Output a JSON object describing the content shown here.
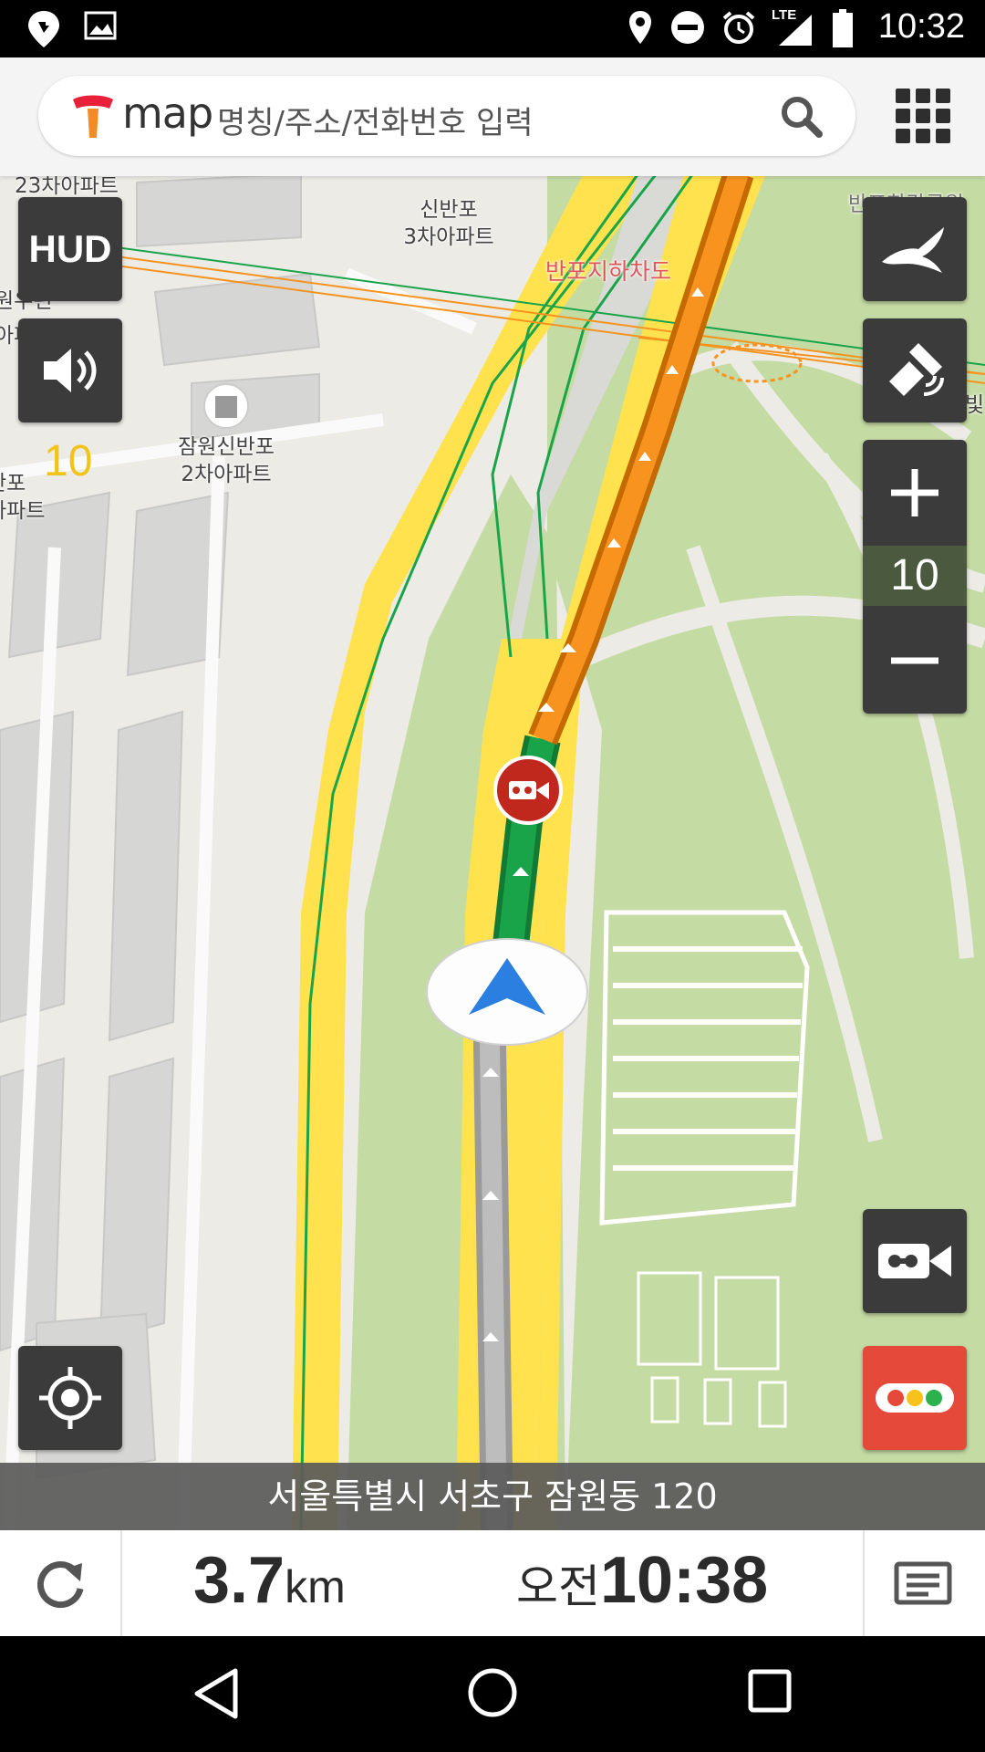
{
  "status_bar": {
    "time": "10:32",
    "network": "LTE",
    "icons": [
      "location-pin-icon",
      "image-icon",
      "location-icon",
      "do-not-disturb-icon",
      "alarm-icon",
      "signal-icon",
      "battery-icon"
    ]
  },
  "search": {
    "logo_text": "map",
    "placeholder": "명칭/주소/전화번호 입력",
    "icons": [
      "tmap-logo-icon",
      "search-icon",
      "menu-grid-icon"
    ]
  },
  "map": {
    "labels": {
      "apt_23": "23차아파트",
      "sinbanpo_3": "신반포\n3차아파트",
      "banpo_underpass": "반포지하차도",
      "jamwon_sinbanpo_2": "잠원신반포\n2차아파트",
      "left_partial_1": "원우편",
      "left_partial_2": "아파",
      "left_partial_3": "반포\n아파트",
      "right_partial_1": "반포한강공원",
      "right_partial_2": "빛"
    },
    "speed_limit": "10"
  },
  "controls": {
    "hud_label": "HUD",
    "zoom_level": "10",
    "icons": [
      "volume-icon",
      "bird-view-icon",
      "satellite-icon",
      "zoom-in-icon",
      "zoom-out-icon",
      "current-location-icon",
      "camera-icon",
      "traffic-light-icon"
    ]
  },
  "address": "서울특별시 서초구 잠원동  120",
  "info": {
    "distance_value": "3.7",
    "distance_unit": "km",
    "eta_ampm": "오전",
    "eta_time": "10:38"
  },
  "colors": {
    "route_orange": "#f7931e",
    "route_green": "#1aa44a",
    "road_yellow": "#ffe24d",
    "park_green": "#c3d9a2",
    "traffic_button": "#e5493a",
    "control_bg": "#3b3b3b"
  }
}
